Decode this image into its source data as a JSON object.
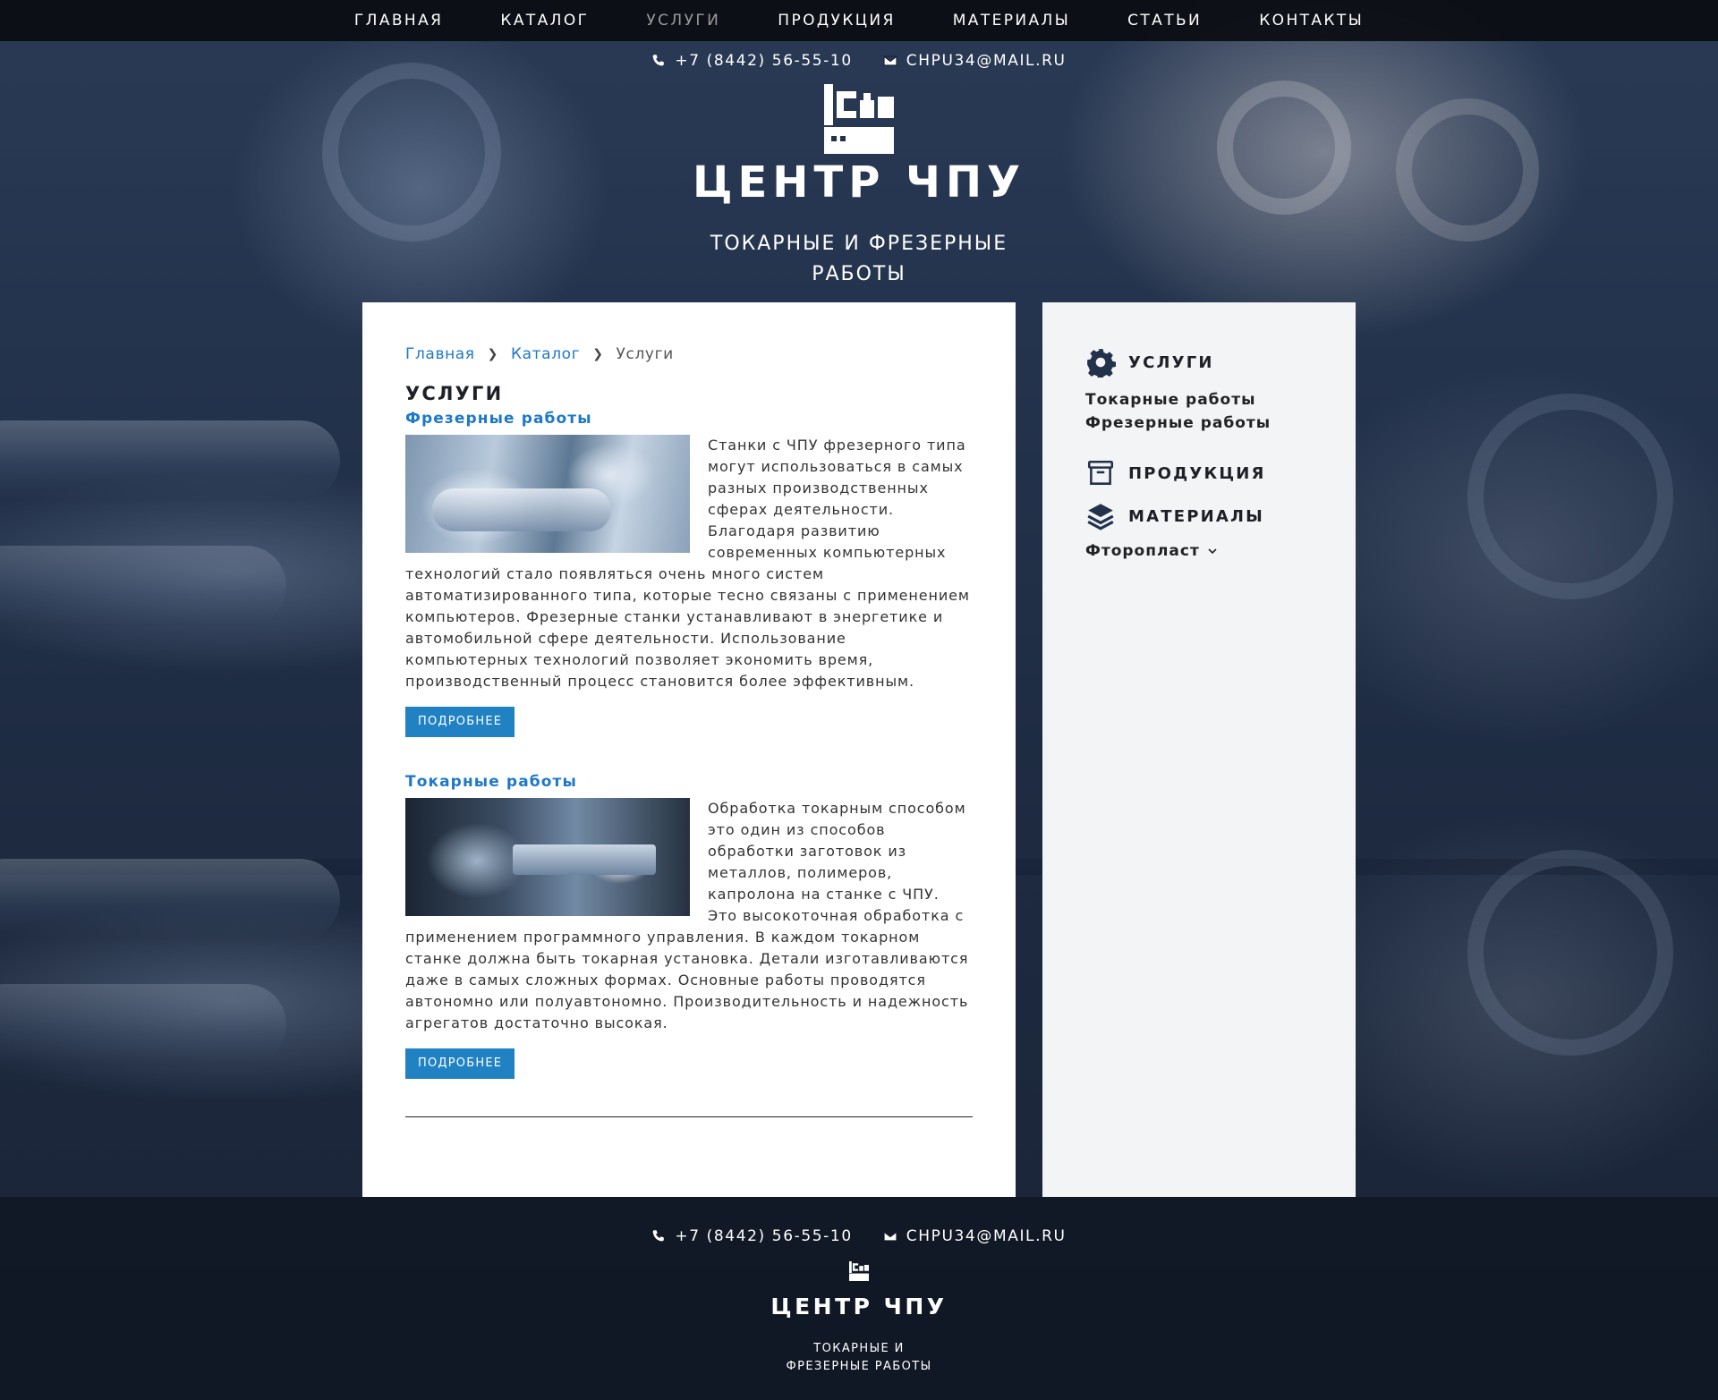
{
  "nav": {
    "items": [
      {
        "label": "ГЛАВНАЯ"
      },
      {
        "label": "КАТАЛОГ"
      },
      {
        "label": "УСЛУГИ"
      },
      {
        "label": "ПРОДУКЦИЯ"
      },
      {
        "label": "МАТЕРИАЛЫ"
      },
      {
        "label": "СТАТЬИ"
      },
      {
        "label": "КОНТАКТЫ"
      }
    ],
    "active_index": 2
  },
  "header": {
    "phone": "+7 (8442) 56-55-10",
    "email": "CHPU34@MAIL.RU",
    "title": "ЦЕНТР ЧПУ",
    "subtitle": "ТОКАРНЫЕ И ФРЕЗЕРНЫЕ РАБОТЫ"
  },
  "breadcrumb": {
    "home": "Главная",
    "catalog": "Каталог",
    "current": "Услуги"
  },
  "main": {
    "title": "УСЛУГИ",
    "services": [
      {
        "title": "Фрезерные работы",
        "text": "Станки с ЧПУ фрезерного типа могут использоваться в самых разных производственных сферах деятельности. Благодаря развитию современных компьютерных технологий стало появляться очень много систем автоматизированного типа, которые тесно связаны с применением компьютеров. Фрезерные станки устанавливают в энергетике и автомобильной сфере деятельности. Использование компьютерных технологий позволяет экономить время, производственный процесс становится более эффективным.",
        "button": "ПОДРОБНЕЕ"
      },
      {
        "title": "Токарные работы",
        "text": "Обработка токарным способом это один из способов обработки заготовок из металлов, полимеров, капролона на станке с ЧПУ. Это высокоточная обработка с применением программного управления. В каждом токарном станке должна быть токарная установка. Детали изготавливаются даже в самых сложных формах. Основные работы проводятся автономно или полуавтономно. Производительность и надежность агрегатов достаточно высокая.",
        "button": "ПОДРОБНЕЕ"
      }
    ]
  },
  "sidebar": {
    "services_heading": "УСЛУГИ",
    "services_links": [
      "Токарные работы",
      "Фрезерные работы"
    ],
    "products_heading": "ПРОДУКЦИЯ",
    "materials_heading": "МАТЕРИАЛЫ",
    "materials_dropdown": "Фторопласт"
  },
  "footer": {
    "phone": "+7 (8442) 56-55-10",
    "email": "CHPU34@MAIL.RU",
    "title": "ЦЕНТР ЧПУ",
    "subtitle": "ТОКАРНЫЕ И ФРЕЗЕРНЫЕ РАБОТЫ"
  },
  "colors": {
    "accent": "#1e78c8",
    "button": "#2082c3",
    "nav_bg": "#0a0c10",
    "nav_active": "#9a9a9a",
    "sidebar_bg": "#f3f4f6"
  },
  "icons": [
    "phone-icon",
    "envelope-icon",
    "cnc-logo-icon",
    "chevron-right-icon",
    "gear-icon",
    "archive-box-icon",
    "layers-icon",
    "chevron-down-icon"
  ]
}
